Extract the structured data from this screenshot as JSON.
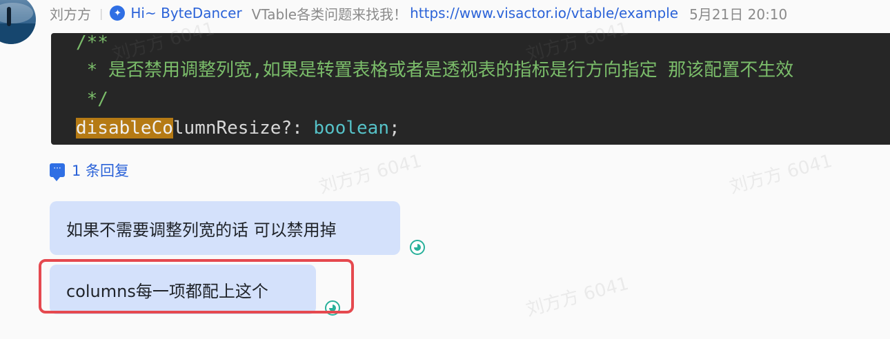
{
  "message": {
    "sender_name": "刘方方",
    "separator": "|",
    "bot_name": "Hi~ ByteDancer",
    "info_text": "VTable各类问题来找我！",
    "link_text": "https://www.visactor.io/vtable/example",
    "timestamp": "5月21日 20:10"
  },
  "code": {
    "line1": "/**",
    "line2": " * 是否禁用调整列宽,如果是转置表格或者是透视表的指标是行方向指定 那该配置不生效",
    "line3": " */",
    "prop_highlight": "disableCo",
    "prop_rest": "lumnResize",
    "prop_punct": "?: ",
    "type_keyword": "boolean",
    "terminator": ";"
  },
  "reply": {
    "label": "1 条回复"
  },
  "bubbles": [
    {
      "text": "如果不需要调整列宽的话 可以禁用掉"
    },
    {
      "text": "columns每一项都配上这个"
    }
  ],
  "watermark": {
    "text": "刘方方 6041"
  },
  "colors": {
    "link": "#2a62d8",
    "bubble_bg": "#d4e1fb",
    "highlight_border": "#e5494f",
    "read_status": "#28b09a"
  }
}
